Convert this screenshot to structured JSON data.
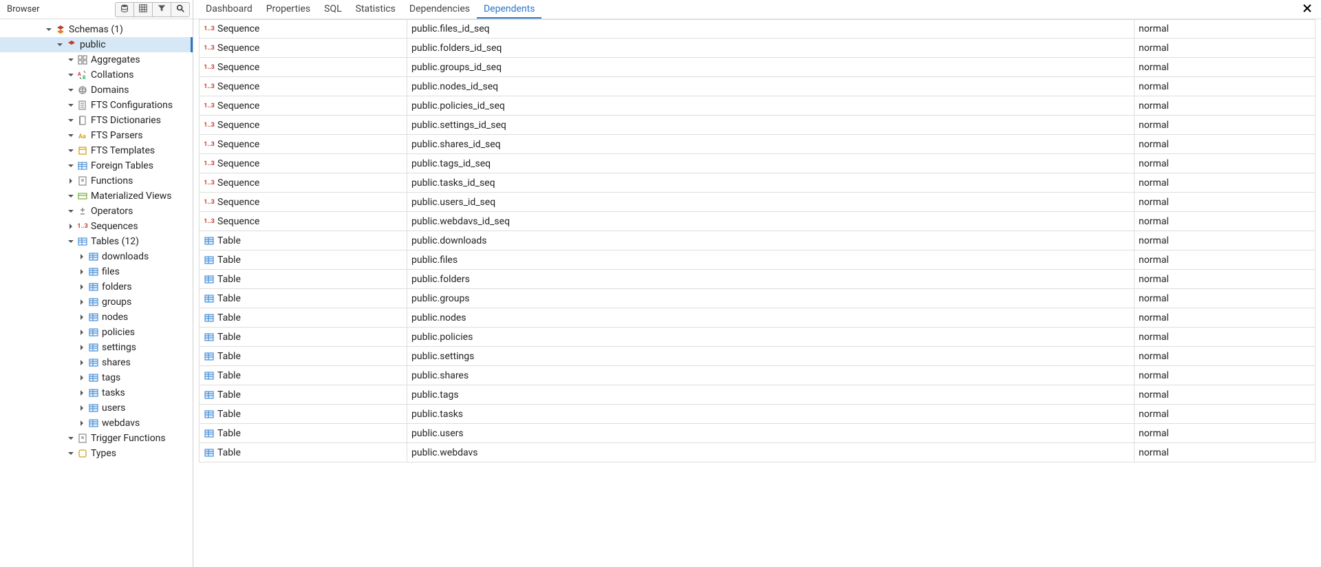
{
  "sidebar": {
    "title": "Browser",
    "tree": [
      {
        "level": 0,
        "expand": "down",
        "icon": "schemas",
        "label": "Schemas (1)"
      },
      {
        "level": 1,
        "expand": "down",
        "icon": "schema",
        "label": "public",
        "selected": true
      },
      {
        "level": 2,
        "expand": "down",
        "icon": "aggregates",
        "label": "Aggregates"
      },
      {
        "level": 2,
        "expand": "down",
        "icon": "collations",
        "label": "Collations"
      },
      {
        "level": 2,
        "expand": "down",
        "icon": "domains",
        "label": "Domains"
      },
      {
        "level": 2,
        "expand": "down",
        "icon": "fts-config",
        "label": "FTS Configurations"
      },
      {
        "level": 2,
        "expand": "down",
        "icon": "fts-dict",
        "label": "FTS Dictionaries"
      },
      {
        "level": 2,
        "expand": "down",
        "icon": "fts-parser",
        "label": "FTS Parsers"
      },
      {
        "level": 2,
        "expand": "down",
        "icon": "fts-template",
        "label": "FTS Templates"
      },
      {
        "level": 2,
        "expand": "down",
        "icon": "foreign-tables",
        "label": "Foreign Tables"
      },
      {
        "level": 2,
        "expand": "right",
        "icon": "functions",
        "label": "Functions"
      },
      {
        "level": 2,
        "expand": "down",
        "icon": "mat-views",
        "label": "Materialized Views"
      },
      {
        "level": 2,
        "expand": "down",
        "icon": "operators",
        "label": "Operators"
      },
      {
        "level": 2,
        "expand": "right",
        "icon": "sequence",
        "label": "Sequences"
      },
      {
        "level": 2,
        "expand": "down",
        "icon": "tables",
        "label": "Tables (12)"
      },
      {
        "level": 3,
        "expand": "right",
        "icon": "table",
        "label": "downloads"
      },
      {
        "level": 3,
        "expand": "right",
        "icon": "table",
        "label": "files"
      },
      {
        "level": 3,
        "expand": "right",
        "icon": "table",
        "label": "folders"
      },
      {
        "level": 3,
        "expand": "right",
        "icon": "table",
        "label": "groups"
      },
      {
        "level": 3,
        "expand": "right",
        "icon": "table",
        "label": "nodes"
      },
      {
        "level": 3,
        "expand": "right",
        "icon": "table",
        "label": "policies"
      },
      {
        "level": 3,
        "expand": "right",
        "icon": "table",
        "label": "settings"
      },
      {
        "level": 3,
        "expand": "right",
        "icon": "table",
        "label": "shares"
      },
      {
        "level": 3,
        "expand": "right",
        "icon": "table",
        "label": "tags"
      },
      {
        "level": 3,
        "expand": "right",
        "icon": "table",
        "label": "tasks"
      },
      {
        "level": 3,
        "expand": "right",
        "icon": "table",
        "label": "users"
      },
      {
        "level": 3,
        "expand": "right",
        "icon": "table",
        "label": "webdavs"
      },
      {
        "level": 2,
        "expand": "down",
        "icon": "trigger-fn",
        "label": "Trigger Functions"
      },
      {
        "level": 2,
        "expand": "down",
        "icon": "types",
        "label": "Types"
      }
    ]
  },
  "tabs": [
    {
      "label": "Dashboard",
      "active": false
    },
    {
      "label": "Properties",
      "active": false
    },
    {
      "label": "SQL",
      "active": false
    },
    {
      "label": "Statistics",
      "active": false
    },
    {
      "label": "Dependencies",
      "active": false
    },
    {
      "label": "Dependents",
      "active": true
    }
  ],
  "grid": [
    {
      "icon": "sequence",
      "type": "Sequence",
      "name": "public.files_id_seq",
      "restriction": "normal"
    },
    {
      "icon": "sequence",
      "type": "Sequence",
      "name": "public.folders_id_seq",
      "restriction": "normal"
    },
    {
      "icon": "sequence",
      "type": "Sequence",
      "name": "public.groups_id_seq",
      "restriction": "normal"
    },
    {
      "icon": "sequence",
      "type": "Sequence",
      "name": "public.nodes_id_seq",
      "restriction": "normal"
    },
    {
      "icon": "sequence",
      "type": "Sequence",
      "name": "public.policies_id_seq",
      "restriction": "normal"
    },
    {
      "icon": "sequence",
      "type": "Sequence",
      "name": "public.settings_id_seq",
      "restriction": "normal"
    },
    {
      "icon": "sequence",
      "type": "Sequence",
      "name": "public.shares_id_seq",
      "restriction": "normal"
    },
    {
      "icon": "sequence",
      "type": "Sequence",
      "name": "public.tags_id_seq",
      "restriction": "normal"
    },
    {
      "icon": "sequence",
      "type": "Sequence",
      "name": "public.tasks_id_seq",
      "restriction": "normal"
    },
    {
      "icon": "sequence",
      "type": "Sequence",
      "name": "public.users_id_seq",
      "restriction": "normal"
    },
    {
      "icon": "sequence",
      "type": "Sequence",
      "name": "public.webdavs_id_seq",
      "restriction": "normal"
    },
    {
      "icon": "table",
      "type": "Table",
      "name": "public.downloads",
      "restriction": "normal"
    },
    {
      "icon": "table",
      "type": "Table",
      "name": "public.files",
      "restriction": "normal"
    },
    {
      "icon": "table",
      "type": "Table",
      "name": "public.folders",
      "restriction": "normal"
    },
    {
      "icon": "table",
      "type": "Table",
      "name": "public.groups",
      "restriction": "normal"
    },
    {
      "icon": "table",
      "type": "Table",
      "name": "public.nodes",
      "restriction": "normal"
    },
    {
      "icon": "table",
      "type": "Table",
      "name": "public.policies",
      "restriction": "normal"
    },
    {
      "icon": "table",
      "type": "Table",
      "name": "public.settings",
      "restriction": "normal"
    },
    {
      "icon": "table",
      "type": "Table",
      "name": "public.shares",
      "restriction": "normal"
    },
    {
      "icon": "table",
      "type": "Table",
      "name": "public.tags",
      "restriction": "normal"
    },
    {
      "icon": "table",
      "type": "Table",
      "name": "public.tasks",
      "restriction": "normal"
    },
    {
      "icon": "table",
      "type": "Table",
      "name": "public.users",
      "restriction": "normal"
    },
    {
      "icon": "table",
      "type": "Table",
      "name": "public.webdavs",
      "restriction": "normal"
    }
  ]
}
